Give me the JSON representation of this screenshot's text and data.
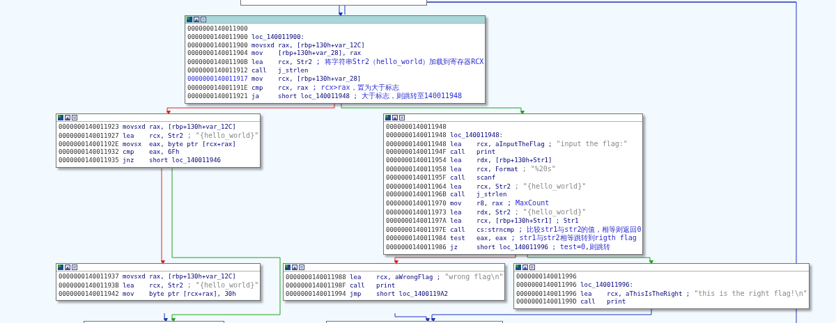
{
  "nodes": [
    {
      "selected": true,
      "lines": [
        {
          "address": "0000000140011900",
          "highlighted": false
        },
        {
          "address": "0000000140011900",
          "label": "loc_140011900:",
          "highlighted": false
        },
        {
          "address": "0000000140011900",
          "mnemonic": "movsxd",
          "operands": "rax, [rbp+130h+var_12C]",
          "highlighted": false
        },
        {
          "address": "0000000140011904",
          "mnemonic": "mov",
          "operands": "[rbp+130h+var_28], rax",
          "highlighted": false
        },
        {
          "address": "000000014001190B",
          "mnemonic": "lea",
          "operands": "rcx, Str2",
          "comment": {
            "text": "; 将字符串Str2（hello_world）加载到寄存器RCX",
            "kind": "note"
          },
          "highlighted": false
        },
        {
          "address": "0000000140011912",
          "mnemonic": "call",
          "operands": "j_strlen",
          "highlighted": false
        },
        {
          "address": "0000000140011917",
          "mnemonic": "mov",
          "operands": "rcx, [rbp+130h+var_28]",
          "highlighted": true
        },
        {
          "address": "000000014001191E",
          "mnemonic": "cmp",
          "operands": "rcx, rax",
          "comment": {
            "text": "; rcx>rax，置为大于标志",
            "kind": "note"
          },
          "highlighted": false
        },
        {
          "address": "0000000140011921",
          "mnemonic": "ja",
          "operands": "short loc_140011948 ;",
          "comment": {
            "text": "大于标志，则跳转至140011948",
            "kind": "note"
          },
          "highlighted": false
        }
      ]
    },
    {
      "selected": false,
      "lines": [
        {
          "address": "0000000140011923",
          "mnemonic": "movsxd",
          "operands": "rax, [rbp+130h+var_12C]",
          "highlighted": false
        },
        {
          "address": "0000000140011927",
          "mnemonic": "lea",
          "operands": "rcx, Str2",
          "comment": {
            "text": "; \"{hello_world}\"",
            "kind": "string"
          },
          "highlighted": false
        },
        {
          "address": "000000014001192E",
          "mnemonic": "movsx",
          "operands": "eax, byte ptr [rcx+rax]",
          "highlighted": false
        },
        {
          "address": "0000000140011932",
          "mnemonic": "cmp",
          "operands": "eax, 6Fh",
          "highlighted": false
        },
        {
          "address": "0000000140011935",
          "mnemonic": "jnz",
          "operands": "short loc_140011946",
          "highlighted": false
        }
      ]
    },
    {
      "selected": false,
      "lines": [
        {
          "address": "0000000140011948",
          "highlighted": false
        },
        {
          "address": "0000000140011948",
          "label": "loc_140011948:",
          "highlighted": false
        },
        {
          "address": "0000000140011948",
          "mnemonic": "lea",
          "operands": "rcx, aInputTheFlag ;",
          "comment": {
            "text": "\"input the flag:\"",
            "kind": "string"
          },
          "highlighted": false
        },
        {
          "address": "000000014001194F",
          "mnemonic": "call",
          "operands": "print",
          "highlighted": false
        },
        {
          "address": "0000000140011954",
          "mnemonic": "lea",
          "operands": "rdx, [rbp+130h+Str1]",
          "highlighted": false
        },
        {
          "address": "0000000140011958",
          "mnemonic": "lea",
          "operands": "rcx, Format",
          "comment": {
            "text": "; \"%20s\"",
            "kind": "string"
          },
          "highlighted": false
        },
        {
          "address": "000000014001195F",
          "mnemonic": "call",
          "operands": "scanf",
          "highlighted": false
        },
        {
          "address": "0000000140011964",
          "mnemonic": "lea",
          "operands": "rcx, Str2",
          "comment": {
            "text": "; \"{hello_world}\"",
            "kind": "string"
          },
          "highlighted": false
        },
        {
          "address": "000000014001196B",
          "mnemonic": "call",
          "operands": "j_strlen",
          "highlighted": false
        },
        {
          "address": "0000000140011970",
          "mnemonic": "mov",
          "operands": "r8, rax",
          "comment": {
            "text": "; MaxCount",
            "kind": "note"
          },
          "highlighted": false
        },
        {
          "address": "0000000140011973",
          "mnemonic": "lea",
          "operands": "rdx, Str2",
          "comment": {
            "text": "; \"{hello_world}\"",
            "kind": "string"
          },
          "highlighted": false
        },
        {
          "address": "000000014001197A",
          "mnemonic": "lea",
          "operands": "rcx, [rbp+130h+Str1] ; Str1",
          "highlighted": false
        },
        {
          "address": "000000014001197E",
          "mnemonic": "call",
          "operands": "cs:strncmp",
          "comment": {
            "text": "; 比较str1与str2的值，相等则返回0",
            "kind": "note"
          },
          "highlighted": false
        },
        {
          "address": "0000000140011984",
          "mnemonic": "test",
          "operands": "eax, eax",
          "comment": {
            "text": "; str1与str2相等跳转到rigth flag",
            "kind": "note"
          },
          "highlighted": false
        },
        {
          "address": "0000000140011986",
          "mnemonic": "jz",
          "operands": "short loc_140011996 ;",
          "comment": {
            "text": "test=0,则跳转",
            "kind": "note"
          },
          "highlighted": false
        }
      ]
    },
    {
      "selected": false,
      "lines": [
        {
          "address": "0000000140011937",
          "mnemonic": "movsxd",
          "operands": "rax, [rbp+130h+var_12C]",
          "highlighted": false
        },
        {
          "address": "000000014001193B",
          "mnemonic": "lea",
          "operands": "rcx, Str2",
          "comment": {
            "text": "; \"{hello_world}\"",
            "kind": "string"
          },
          "highlighted": false
        },
        {
          "address": "0000000140011942",
          "mnemonic": "mov",
          "operands": "byte ptr [rcx+rax], 30h",
          "highlighted": false
        }
      ]
    },
    {
      "selected": false,
      "lines": [
        {
          "address": "0000000140011988",
          "mnemonic": "lea",
          "operands": "rcx, aWrongFlag ;",
          "comment": {
            "text": "\"wrong flag\\n\"",
            "kind": "string"
          },
          "highlighted": false
        },
        {
          "address": "000000014001198F",
          "mnemonic": "call",
          "operands": "print",
          "highlighted": false
        },
        {
          "address": "0000000140011994",
          "mnemonic": "jmp",
          "operands": "short loc_1400119A2",
          "highlighted": false
        }
      ]
    },
    {
      "selected": false,
      "lines": [
        {
          "address": "0000000140011996",
          "highlighted": false
        },
        {
          "address": "0000000140011996",
          "label": "loc_140011996:",
          "highlighted": false
        },
        {
          "address": "0000000140011996",
          "mnemonic": "lea",
          "operands": "rcx, aThisIsTheRight ;",
          "comment": {
            "text": "\"this is the right flag!\\n\"",
            "kind": "string"
          },
          "highlighted": false
        },
        {
          "address": "000000014001199D",
          "mnemonic": "call",
          "operands": "print",
          "highlighted": false
        }
      ]
    }
  ]
}
